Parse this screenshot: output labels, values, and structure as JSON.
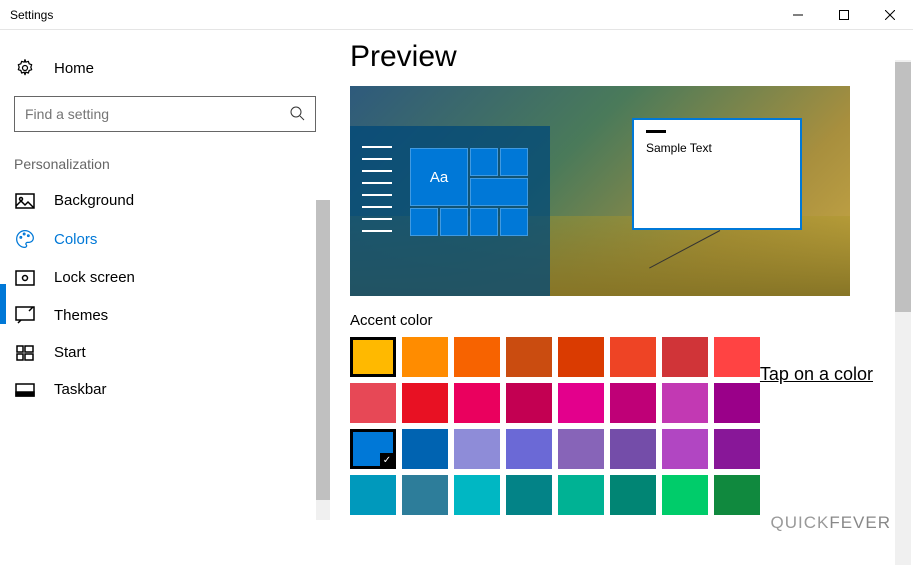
{
  "titlebar": {
    "title": "Settings"
  },
  "sidebar": {
    "home": "Home",
    "search_placeholder": "Find a setting",
    "section": "Personalization",
    "items": [
      {
        "label": "Background"
      },
      {
        "label": "Colors"
      },
      {
        "label": "Lock screen"
      },
      {
        "label": "Themes"
      },
      {
        "label": "Start"
      },
      {
        "label": "Taskbar"
      }
    ]
  },
  "content": {
    "heading": "Preview",
    "sample_text": "Sample Text",
    "aa": "Aa",
    "accent_label": "Accent color",
    "tap_label": "Tap on a color"
  },
  "swatch_rows": [
    [
      "#ffb900",
      "#ff8c00",
      "#f76300",
      "#ca4c10",
      "#da3b01",
      "#ee4425",
      "#d03438",
      "#ff4343"
    ],
    [
      "#e74856",
      "#e81123",
      "#ea005e",
      "#c30052",
      "#e3008c",
      "#bf0077",
      "#c239b3",
      "#9a0089"
    ],
    [
      "#0078d7",
      "#0063b1",
      "#8e8cd8",
      "#6b69d6",
      "#8764b8",
      "#744da9",
      "#b146c2",
      "#881798"
    ],
    [
      "#0099bc",
      "#2d7d9a",
      "#00b7c3",
      "#038387",
      "#00b294",
      "#018574",
      "#00cc6a",
      "#10893e"
    ]
  ],
  "selected": {
    "outer_row": 0,
    "outer_col": 0,
    "check_row": 2,
    "check_col": 0
  },
  "watermark": {
    "a": "QUICK",
    "b": "FEVER"
  }
}
